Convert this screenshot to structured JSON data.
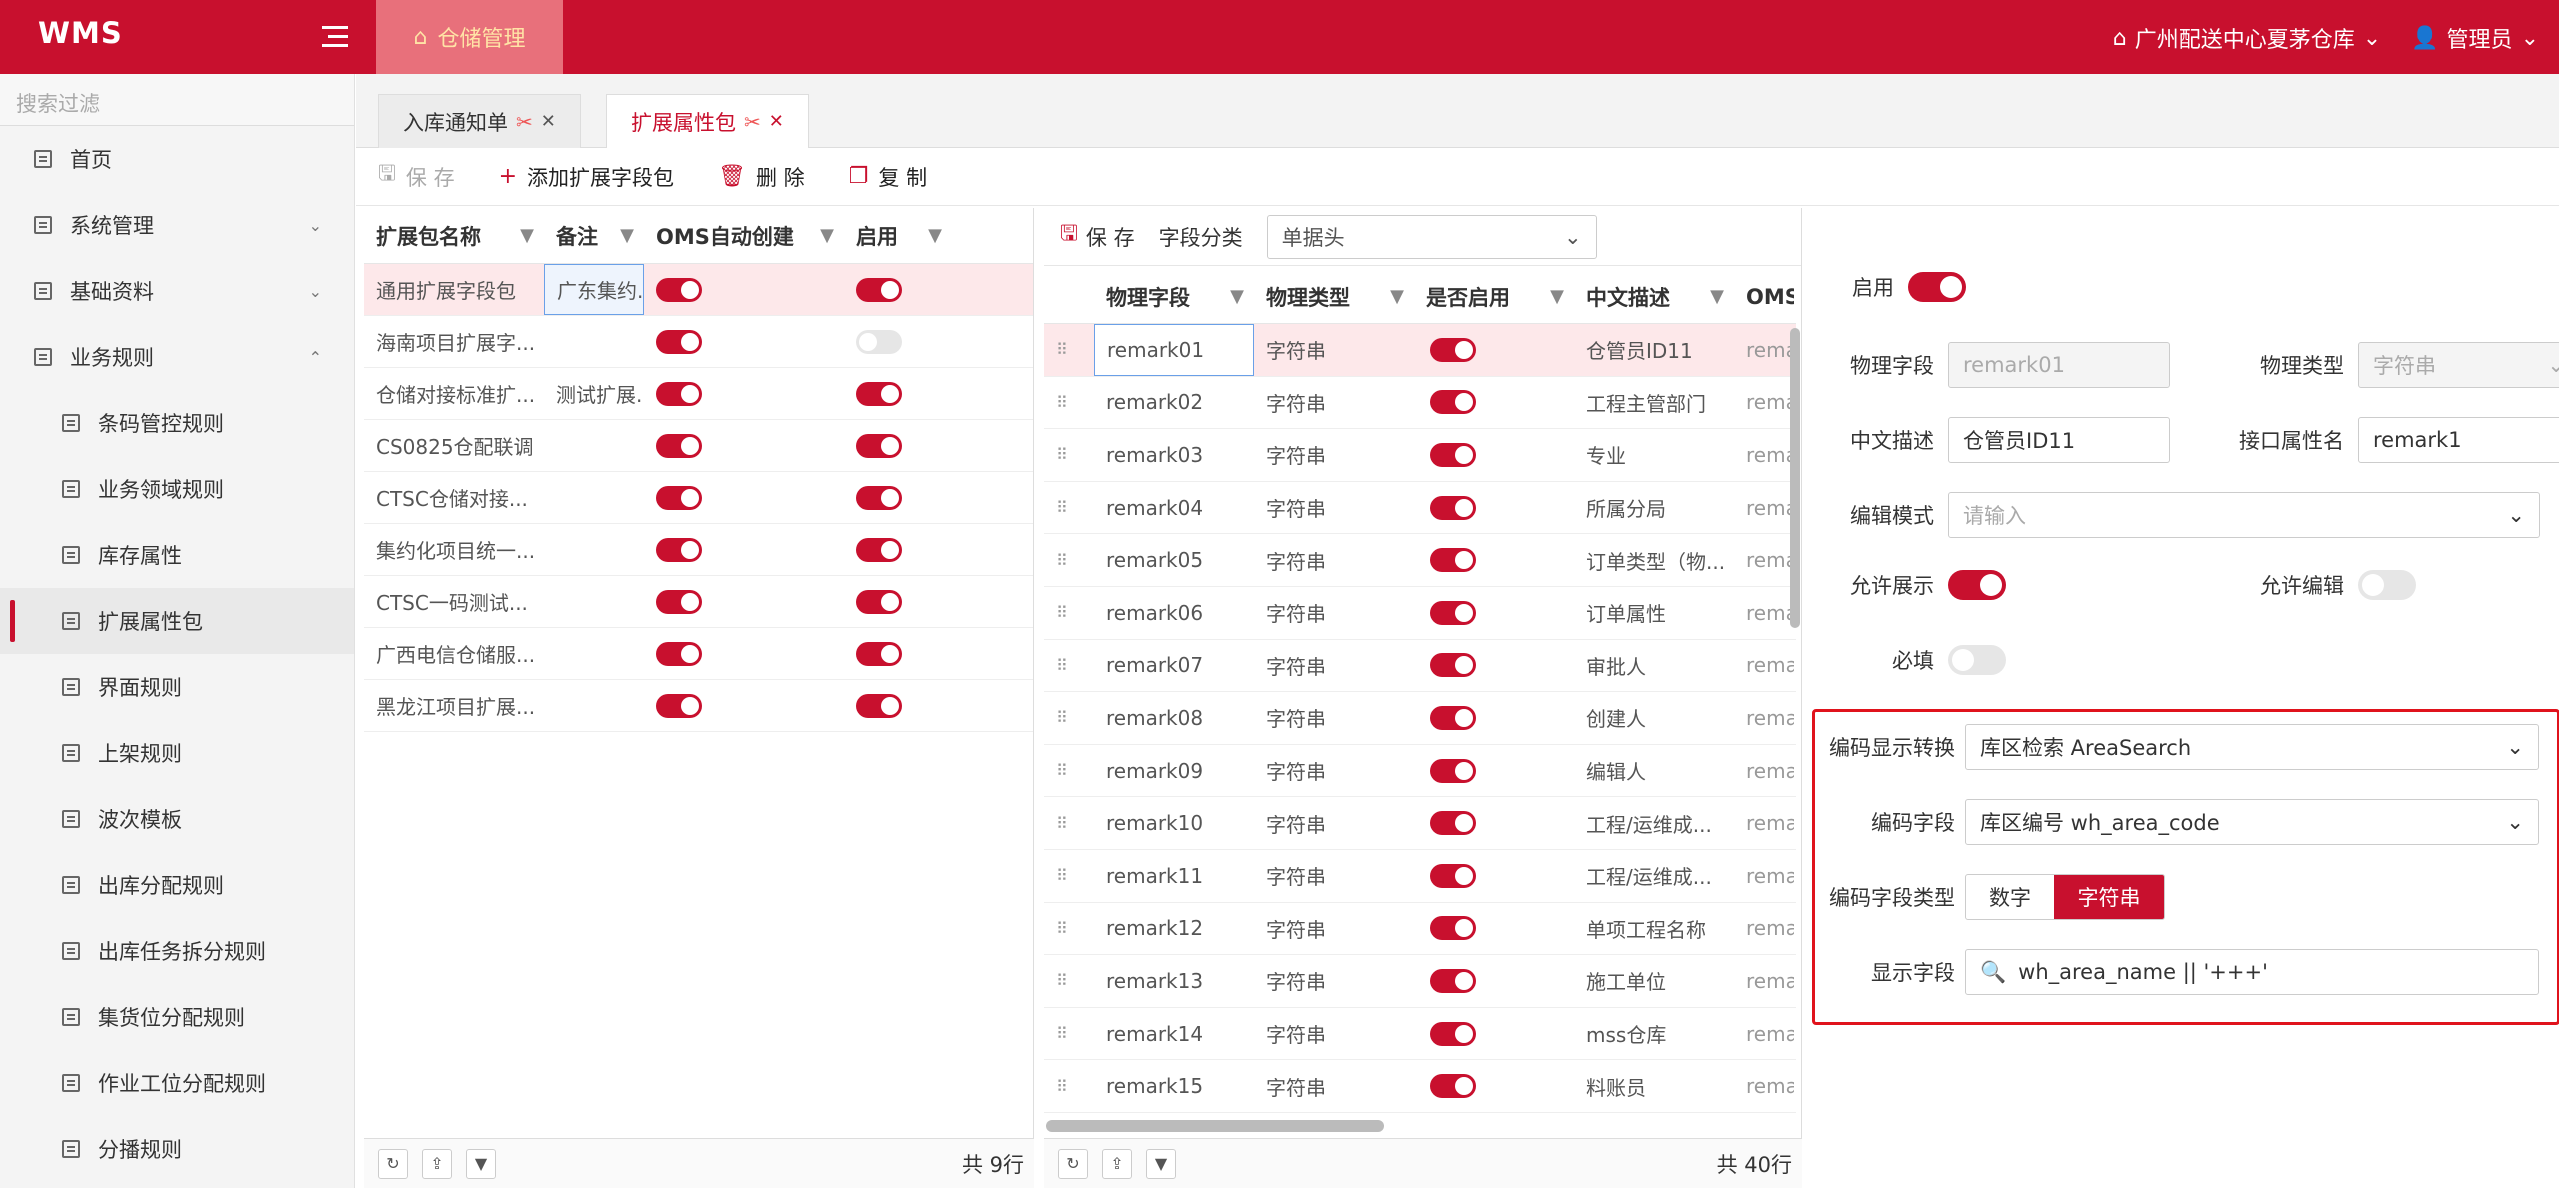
{
  "app": {
    "logo": "WMS",
    "top_tab": "仓储管理",
    "warehouse": "广州配送中心夏茅仓库",
    "user": "管理员"
  },
  "sidebar": {
    "search_placeholder": "搜索过滤",
    "items": [
      {
        "label": "首页"
      },
      {
        "label": "系统管理",
        "chevron": "down"
      },
      {
        "label": "基础资料",
        "chevron": "down"
      },
      {
        "label": "业务规则",
        "chevron": "up"
      }
    ],
    "subitems": [
      {
        "label": "条码管控规则"
      },
      {
        "label": "业务领域规则"
      },
      {
        "label": "库存属性"
      },
      {
        "label": "扩展属性包",
        "active": true
      },
      {
        "label": "界面规则"
      },
      {
        "label": "上架规则"
      },
      {
        "label": "波次模板"
      },
      {
        "label": "出库分配规则"
      },
      {
        "label": "出库任务拆分规则"
      },
      {
        "label": "集货位分配规则"
      },
      {
        "label": "作业工位分配规则"
      },
      {
        "label": "分播规则"
      }
    ]
  },
  "tabs": [
    {
      "label": "入库通知单"
    },
    {
      "label": "扩展属性包"
    }
  ],
  "toolbar": {
    "save": "保 存",
    "add": "添加扩展字段包",
    "delete": "删 除",
    "copy": "复 制"
  },
  "left_grid": {
    "headers": [
      "扩展包名称",
      "备注",
      "OMS自动创建",
      "启用"
    ],
    "rows": [
      {
        "name": "通用扩展字段包",
        "note": "广东集约...",
        "oms": true,
        "enabled": true
      },
      {
        "name": "海南项目扩展字...",
        "note": "",
        "oms": true,
        "enabled": false
      },
      {
        "name": "仓储对接标准扩...",
        "note": "测试扩展...",
        "oms": true,
        "enabled": true
      },
      {
        "name": "CS0825仓配联调",
        "note": "",
        "oms": true,
        "enabled": true
      },
      {
        "name": "CTSC仓储对接...",
        "note": "",
        "oms": true,
        "enabled": true
      },
      {
        "name": "集约化项目统一...",
        "note": "",
        "oms": true,
        "enabled": true
      },
      {
        "name": "CTSC一码测试...",
        "note": "",
        "oms": true,
        "enabled": true
      },
      {
        "name": "广西电信仓储服...",
        "note": "",
        "oms": true,
        "enabled": true
      },
      {
        "name": "黑龙江项目扩展...",
        "note": "",
        "oms": true,
        "enabled": true
      }
    ],
    "count": "共 9行"
  },
  "mid": {
    "save": "保 存",
    "category_label": "字段分类",
    "category_value": "单据头",
    "headers": [
      "物理字段",
      "物理类型",
      "是否启用",
      "中文描述",
      "OMS"
    ],
    "rows": [
      {
        "field": "remark01",
        "type": "字符串",
        "desc": "仓管员ID11",
        "oms": "rema"
      },
      {
        "field": "remark02",
        "type": "字符串",
        "desc": "工程主管部门",
        "oms": "rema"
      },
      {
        "field": "remark03",
        "type": "字符串",
        "desc": "专业",
        "oms": "rema"
      },
      {
        "field": "remark04",
        "type": "字符串",
        "desc": "所属分局",
        "oms": "rema"
      },
      {
        "field": "remark05",
        "type": "字符串",
        "desc": "订单类型（物...",
        "oms": "rema"
      },
      {
        "field": "remark06",
        "type": "字符串",
        "desc": "订单属性",
        "oms": "rema"
      },
      {
        "field": "remark07",
        "type": "字符串",
        "desc": "审批人",
        "oms": "rema"
      },
      {
        "field": "remark08",
        "type": "字符串",
        "desc": "创建人",
        "oms": "rema"
      },
      {
        "field": "remark09",
        "type": "字符串",
        "desc": "编辑人",
        "oms": "rema"
      },
      {
        "field": "remark10",
        "type": "字符串",
        "desc": "工程/运维成...",
        "oms": "rema"
      },
      {
        "field": "remark11",
        "type": "字符串",
        "desc": "工程/运维成...",
        "oms": "rema"
      },
      {
        "field": "remark12",
        "type": "字符串",
        "desc": "单项工程名称",
        "oms": "rema"
      },
      {
        "field": "remark13",
        "type": "字符串",
        "desc": "施工单位",
        "oms": "rema"
      },
      {
        "field": "remark14",
        "type": "字符串",
        "desc": "mss仓库",
        "oms": "rema"
      },
      {
        "field": "remark15",
        "type": "字符串",
        "desc": "料账员",
        "oms": "rema"
      }
    ],
    "count": "共 40行"
  },
  "form": {
    "enable_label": "启用",
    "phys_field_label": "物理字段",
    "phys_field": "remark01",
    "phys_type_label": "物理类型",
    "phys_type": "字符串",
    "cn_desc_label": "中文描述",
    "cn_desc": "仓管员ID11",
    "api_name_label": "接口属性名",
    "api_name": "remark1",
    "edit_mode_label": "编辑模式",
    "edit_mode_placeholder": "请输入",
    "allow_show_label": "允许展示",
    "allow_edit_label": "允许编辑",
    "required_label": "必填",
    "code_convert_label": "编码显示转换",
    "code_convert": "库区检索 AreaSearch",
    "code_field_label": "编码字段",
    "code_field": "库区编号 wh_area_code",
    "code_type_label": "编码字段类型",
    "code_type_options": [
      "数字",
      "字符串"
    ],
    "code_type_selected": "字符串",
    "display_field_label": "显示字段",
    "display_field": "wh_area_name || '+++'"
  }
}
